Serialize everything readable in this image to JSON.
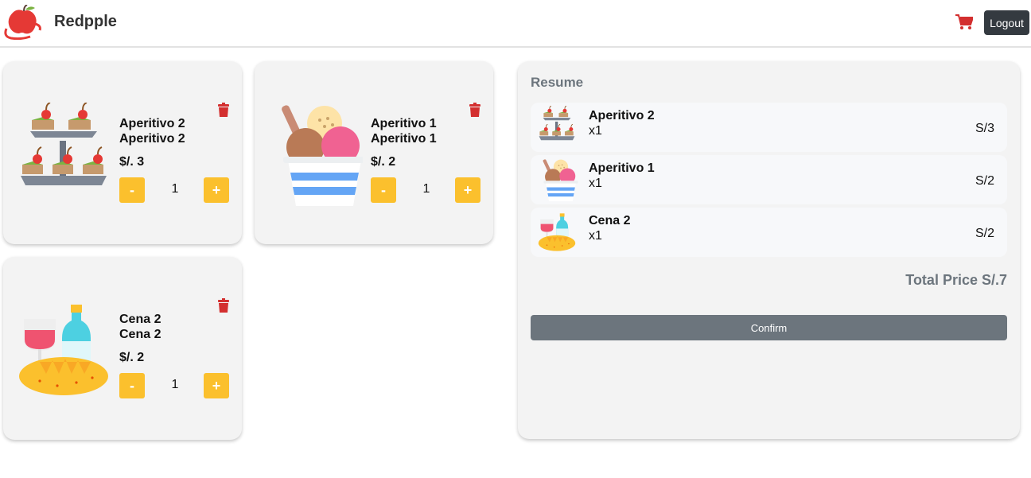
{
  "header": {
    "brand": "Redpple",
    "logout_label": "Logout"
  },
  "icons": {
    "logo": "apple-logo-icon",
    "cart": "cart-icon",
    "delete": "trash-icon"
  },
  "colors": {
    "accent": "#fbc02d",
    "danger": "#d32f2f",
    "dark": "#343a40",
    "muted": "#6c757d"
  },
  "products": [
    {
      "name": "Aperitivo 2",
      "description": "Aperitivo 2",
      "price": "$/. 3",
      "quantity": "1",
      "image": "appetizer-tray-image"
    },
    {
      "name": "Aperitivo 1",
      "description": "Aperitivo 1",
      "price": "$/. 2",
      "quantity": "1",
      "image": "ice-cream-cup-image"
    },
    {
      "name": "Cena 2",
      "description": "Cena 2",
      "price": "$/. 2",
      "quantity": "1",
      "image": "wine-bread-image"
    }
  ],
  "buttons": {
    "minus": "-",
    "plus": "+"
  },
  "resume": {
    "title": "Resume",
    "items": [
      {
        "name": "Aperitivo 2",
        "qty": "x1",
        "price": "S/3"
      },
      {
        "name": "Aperitivo 1",
        "qty": "x1",
        "price": "S/2"
      },
      {
        "name": "Cena 2",
        "qty": "x1",
        "price": "S/2"
      }
    ],
    "total": "Total Price S/.7",
    "confirm_label": "Confirm"
  }
}
